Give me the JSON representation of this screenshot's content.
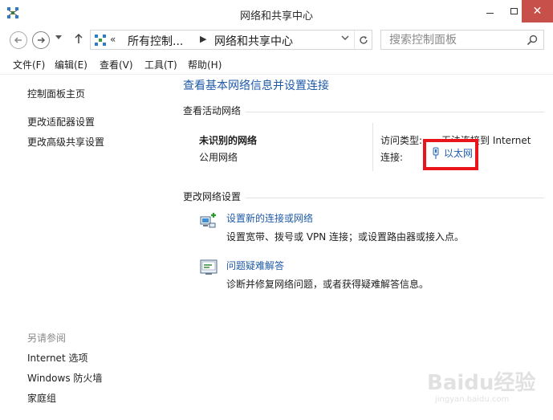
{
  "window": {
    "title": "网络和共享中心",
    "close_glyph": "✕"
  },
  "address": {
    "chevron": "«",
    "crumbs": [
      "所有控制...",
      "网络和共享中心"
    ],
    "separator": "▶"
  },
  "search": {
    "placeholder": "搜索控制面板"
  },
  "menu": [
    "文件(F)",
    "编辑(E)",
    "查看(V)",
    "工具(T)",
    "帮助(H)"
  ],
  "sidebar": {
    "links": [
      "控制面板主页",
      "更改适配器设置",
      "更改高级共享设置"
    ],
    "see_also_heading": "另请参阅",
    "see_also": [
      "Internet 选项",
      "Windows 防火墙",
      "家庭组"
    ]
  },
  "main": {
    "title": "查看基本网络信息并设置连接",
    "active_networks_label": "查看活动网络",
    "network_name": "未识别的网络",
    "network_type": "公用网络",
    "access_type_label": "访问类型:",
    "access_type_value": "无法连接到 Internet",
    "connections_label": "连接:",
    "connection_name": "以太网",
    "change_settings_label": "更改网络设置",
    "tasks": [
      {
        "icon": "network-setup-icon",
        "title": "设置新的连接或网络",
        "description": "设置宽带、拨号或 VPN 连接；或设置路由器或接入点。"
      },
      {
        "icon": "troubleshoot-icon",
        "title": "问题疑难解答",
        "description": "诊断并修复网络问题，或者获得疑难解答信息。"
      }
    ]
  },
  "watermark": {
    "text": "Baidu经验",
    "subtext": "jingyan.baidu.com"
  },
  "colors": {
    "link": "#1e5aa8",
    "highlight_box": "#e8151b",
    "close_button": "#c7504a"
  }
}
